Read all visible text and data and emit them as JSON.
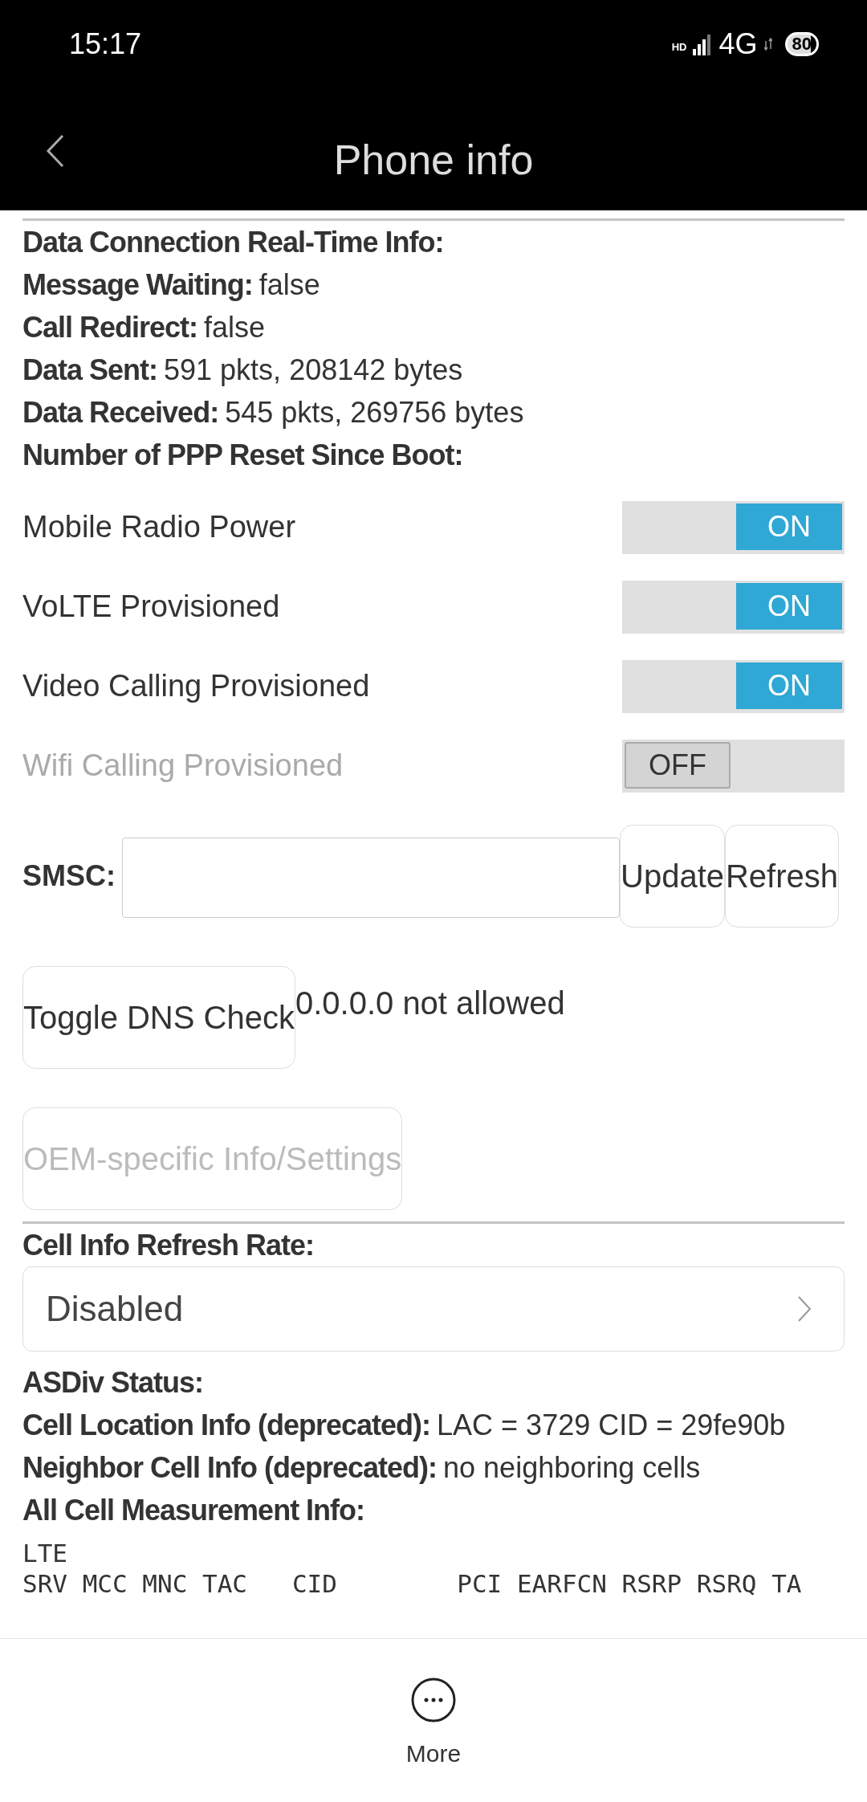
{
  "status_bar": {
    "time": "15:17",
    "hd": "HD",
    "network": "4G",
    "battery": "80"
  },
  "header": {
    "title": "Phone info"
  },
  "info_lines": [
    {
      "label": "Data Connection Real-Time Info:"
    },
    {
      "label": "Message Waiting:",
      "value": "false"
    },
    {
      "label": "Call Redirect:",
      "value": "false"
    },
    {
      "label": "Data Sent:",
      "value": "591 pkts, 208142 bytes"
    },
    {
      "label": "Data Received:",
      "value": "545 pkts, 269756 bytes"
    },
    {
      "label": "Number of PPP Reset Since Boot:"
    }
  ],
  "toggles": [
    {
      "label": "Mobile Radio Power",
      "on": true,
      "disabled": false,
      "state_text": "ON"
    },
    {
      "label": "VoLTE Provisioned",
      "on": true,
      "disabled": false,
      "state_text": "ON"
    },
    {
      "label": "Video Calling Provisioned",
      "on": true,
      "disabled": false,
      "state_text": "ON"
    },
    {
      "label": "Wifi Calling Provisioned",
      "on": false,
      "disabled": true,
      "state_text": "OFF"
    }
  ],
  "smsc": {
    "label": "SMSC:",
    "buttons": [
      "Update",
      "Refresh"
    ]
  },
  "dns": {
    "button": "Toggle DNS Check",
    "status": "0.0.0.0 not allowed"
  },
  "oem_button": {
    "label": "OEM-specific Info/Settings",
    "disabled": true
  },
  "cell_refresh": {
    "label": "Cell Info Refresh Rate:",
    "value": "Disabled"
  },
  "cell_lines": [
    {
      "label": "ASDiv Status:"
    },
    {
      "label": "Cell Location Info (deprecated):",
      "value": "LAC = 3729   CID = 29fe90b"
    },
    {
      "label": "Neighbor Cell Info (deprecated):",
      "value": "no neighboring cells"
    },
    {
      "label": "All Cell Measurement Info:"
    }
  ],
  "measurement_lines": [
    "LTE",
    "SRV MCC MNC TAC   CID        PCI EARFCN RSRP RSRQ TA"
  ],
  "bottom_bar": {
    "more": "More"
  }
}
